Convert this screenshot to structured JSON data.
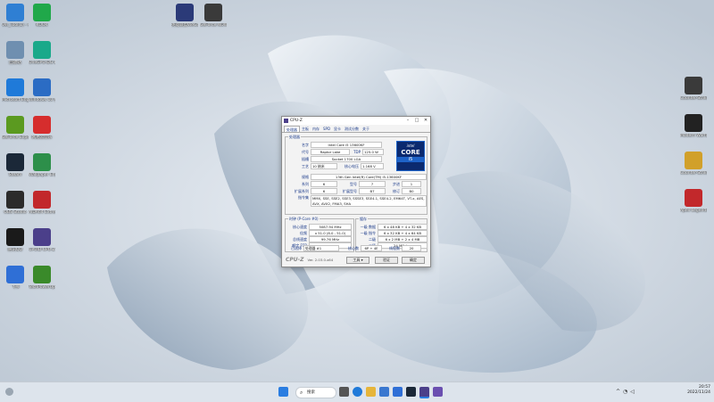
{
  "desktop": {
    "left_column": [
      {
        "label": "Ver_Tool(1) - 64 Monitor",
        "color": "#2f7fd3",
        "icon": "monitor-icon"
      },
      {
        "label": "KOOK",
        "color": "#20a84a",
        "icon": "kook-icon"
      },
      {
        "label": "回收站",
        "color": "#6f8fb0",
        "icon": "recycle-bin-icon"
      },
      {
        "label": "OneGPU-DG Lite Edition",
        "color": "#1aa98a",
        "icon": "gpu-icon"
      },
      {
        "label": "Microsoft Edge",
        "color": "#1f7ad9",
        "icon": "edge-icon"
      },
      {
        "label": "Windows 10 更新助手",
        "color": "#2b6cc4",
        "icon": "update-icon"
      },
      {
        "label": "GeForce Experience",
        "color": "#5b9a20",
        "icon": "nvidia-icon"
      },
      {
        "label": "网易云音乐",
        "color": "#d62d2d",
        "icon": "netease-music-icon"
      },
      {
        "label": "Steam",
        "color": "#1b2838",
        "icon": "steam-icon"
      },
      {
        "label": "Wallpaper Engine",
        "color": "#2d8f4a",
        "icon": "wallpaper-engine-icon"
      },
      {
        "label": "OBS Studio",
        "color": "#2b2b2b",
        "icon": "obs-icon"
      },
      {
        "label": "AIDA64 Extreme",
        "color": "#c2282b",
        "icon": "aida64-icon"
      },
      {
        "label": "腾讯QQ",
        "color": "#1a1a1a",
        "icon": "qq-icon"
      },
      {
        "label": "CPUID CPU-Z",
        "color": "#4b3f8a",
        "icon": "cpuz-icon"
      },
      {
        "label": "飞书",
        "color": "#2f6fd6",
        "icon": "feishu-icon"
      },
      {
        "label": "TechPowerUp",
        "color": "#3a8a2a",
        "icon": "gpuz-icon"
      }
    ],
    "top_icons": [
      {
        "label": "英雄联盟WeGame",
        "color": "#2b3a78",
        "icon": "wegame-icon"
      },
      {
        "label": "GeForce NOW",
        "color": "#3a3a3a",
        "icon": "geforce-now-icon"
      }
    ],
    "right_column": [
      {
        "label": "Counter-Strike Global",
        "color": "#3a3a3a",
        "icon": "csgo-icon"
      },
      {
        "label": "Modern Warfare II",
        "color": "#222222",
        "icon": "mw2-icon"
      },
      {
        "label": "Counter-Strike 2",
        "color": "#d1a02a",
        "icon": "cs2-icon"
      },
      {
        "label": "Apex Legends",
        "color": "#c2282b",
        "icon": "apex-icon"
      }
    ]
  },
  "cpuz": {
    "title": "CPU-Z",
    "tabs": [
      "处理器",
      "主板",
      "内存",
      "SPD",
      "显卡",
      "测试分数",
      "关于"
    ],
    "processor_group": "处理器",
    "fields": {
      "name_label": "名字",
      "name": "Intel Core i5 13600KF",
      "codename_label": "代号",
      "codename": "Raptor Lake",
      "tdp_label": "TDP",
      "tdp": "125.0 W",
      "package_label": "插槽",
      "package": "Socket 1700 LGA",
      "tech_label": "工艺",
      "tech": "10 纳米",
      "voltage_label": "核心电压",
      "voltage": "1.168 V",
      "spec_label": "规格",
      "spec": "13th Gen Intel(R) Core(TM) i5-13600KF",
      "family_label": "系列",
      "family": "6",
      "model_label": "型号",
      "model": "7",
      "stepping_label": "步进",
      "stepping": "1",
      "extfamily_label": "扩展系列",
      "extfamily": "6",
      "extmodel_label": "扩展型号",
      "extmodel": "B7",
      "revision_label": "修订",
      "revision": "B0",
      "instr_label": "指令集",
      "instr": "MMX, SSE, SSE2, SSE3, SSSE3, SSE4.1, SSE4.2, EM64T, VT-x, AES, AVX, AVX2, FMA3, SHA"
    },
    "intel_badge": {
      "brand": "intel",
      "line": "CORE",
      "tier": "i5"
    },
    "clocks_group": "时钟 (P-Core #0)",
    "clocks": {
      "core_speed_label": "核心速度",
      "core_speed": "5087.94 MHz",
      "multiplier_label": "倍频",
      "multiplier": "x 51.0 (8.0 - 51.0)",
      "bus_label": "总线速度",
      "bus": "99.76 MHz",
      "fsb_label": "额定 FSB",
      "fsb": ""
    },
    "cache_group": "缓存",
    "cache": [
      {
        "label": "一级 数据",
        "value": "6 x 48 KB + 4 x 32 KB"
      },
      {
        "label": "一级 指令",
        "value": "6 x 32 KB + 4 x 64 KB"
      },
      {
        "label": "二级",
        "value": "6 x 2 MB + 2 x 4 MB"
      },
      {
        "label": "三级",
        "value": "24 MBytes"
      }
    ],
    "selection_label": "已选择",
    "selection": "处理器 #1",
    "cores_label": "核心数",
    "cores": "6P + 4E",
    "threads_label": "线程数",
    "threads": "20",
    "footer_brand": "CPU-Z",
    "version": "Ver. 2.03.0.x64",
    "tools_label": "工具",
    "validate_label": "验证",
    "ok_label": "确定"
  },
  "taskbar": {
    "search_placeholder": "搜索",
    "time": "20:57",
    "date": "2022/11/24",
    "apps": [
      {
        "name": "start-icon",
        "color": "#2a7de1"
      },
      {
        "name": "task-view-icon",
        "color": "#555555"
      },
      {
        "name": "edge-icon",
        "color": "#1f7ad9"
      },
      {
        "name": "explorer-icon",
        "color": "#e6b53a"
      },
      {
        "name": "store-icon",
        "color": "#3a78d0"
      },
      {
        "name": "mail-icon",
        "color": "#2f6fd6"
      },
      {
        "name": "steam-icon",
        "color": "#1b2838"
      },
      {
        "name": "cpuz-icon",
        "color": "#4b3f8a"
      }
    ]
  }
}
